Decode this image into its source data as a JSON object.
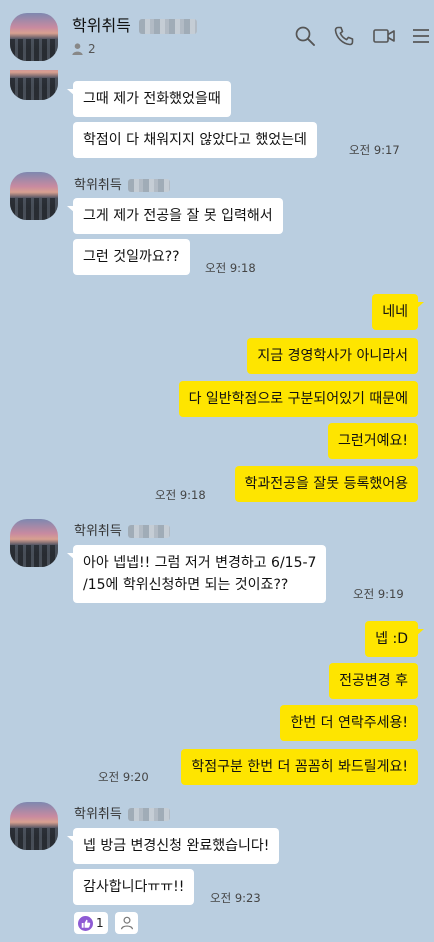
{
  "header": {
    "title": "학위취득",
    "member_count": "2",
    "icons": [
      "search-icon",
      "phone-icon",
      "video-call-icon",
      "menu-icon"
    ]
  },
  "senders": [
    "학위취득",
    "학위취득",
    "학위취득"
  ],
  "messages": [
    {
      "side": "in",
      "text": "그때 제가 전화했었을때",
      "time": ""
    },
    {
      "side": "in",
      "text": "학점이 다 채워지지 않았다고 했었는데",
      "time": "오전 9:17"
    },
    {
      "side": "in",
      "text": "그게 제가 전공을 잘 못 입력해서",
      "time": ""
    },
    {
      "side": "in",
      "text": "그런 것일까요??",
      "time": "오전 9:18"
    },
    {
      "side": "out",
      "text": "네네",
      "time": ""
    },
    {
      "side": "out",
      "text": "지금 경영학사가 아니라서",
      "time": ""
    },
    {
      "side": "out",
      "text": "다 일반학점으로 구분되어있기 때문에",
      "time": ""
    },
    {
      "side": "out",
      "text": "그런거예요!",
      "time": ""
    },
    {
      "side": "out",
      "text": "학과전공을 잘못 등록했어용",
      "time": "오전 9:18"
    },
    {
      "side": "in",
      "text": "아아 넵넵!! 그럼 저거 변경하고 6/15-7\n/15에 학위신청하면 되는 것이죠??",
      "time": "오전 9:19"
    },
    {
      "side": "out",
      "text": "넵 :D",
      "time": ""
    },
    {
      "side": "out",
      "text": "전공변경 후",
      "time": ""
    },
    {
      "side": "out",
      "text": "한번 더 연락주세용!",
      "time": ""
    },
    {
      "side": "out",
      "text": "학점구분 한번 더 꼼꼼히 봐드릴게요!",
      "time": "오전 9:20"
    },
    {
      "side": "in",
      "text": "넵 방금 변경신청 완료했습니다!",
      "time": ""
    },
    {
      "side": "in",
      "text": "감사합니다ㅠㅠ!!",
      "time": "오전 9:23"
    }
  ],
  "reaction": {
    "count": "1",
    "icon": "thumbs-up-icon"
  },
  "colors": {
    "background": "#bacee0",
    "outgoing": "#fee500",
    "incoming": "#ffffff"
  }
}
